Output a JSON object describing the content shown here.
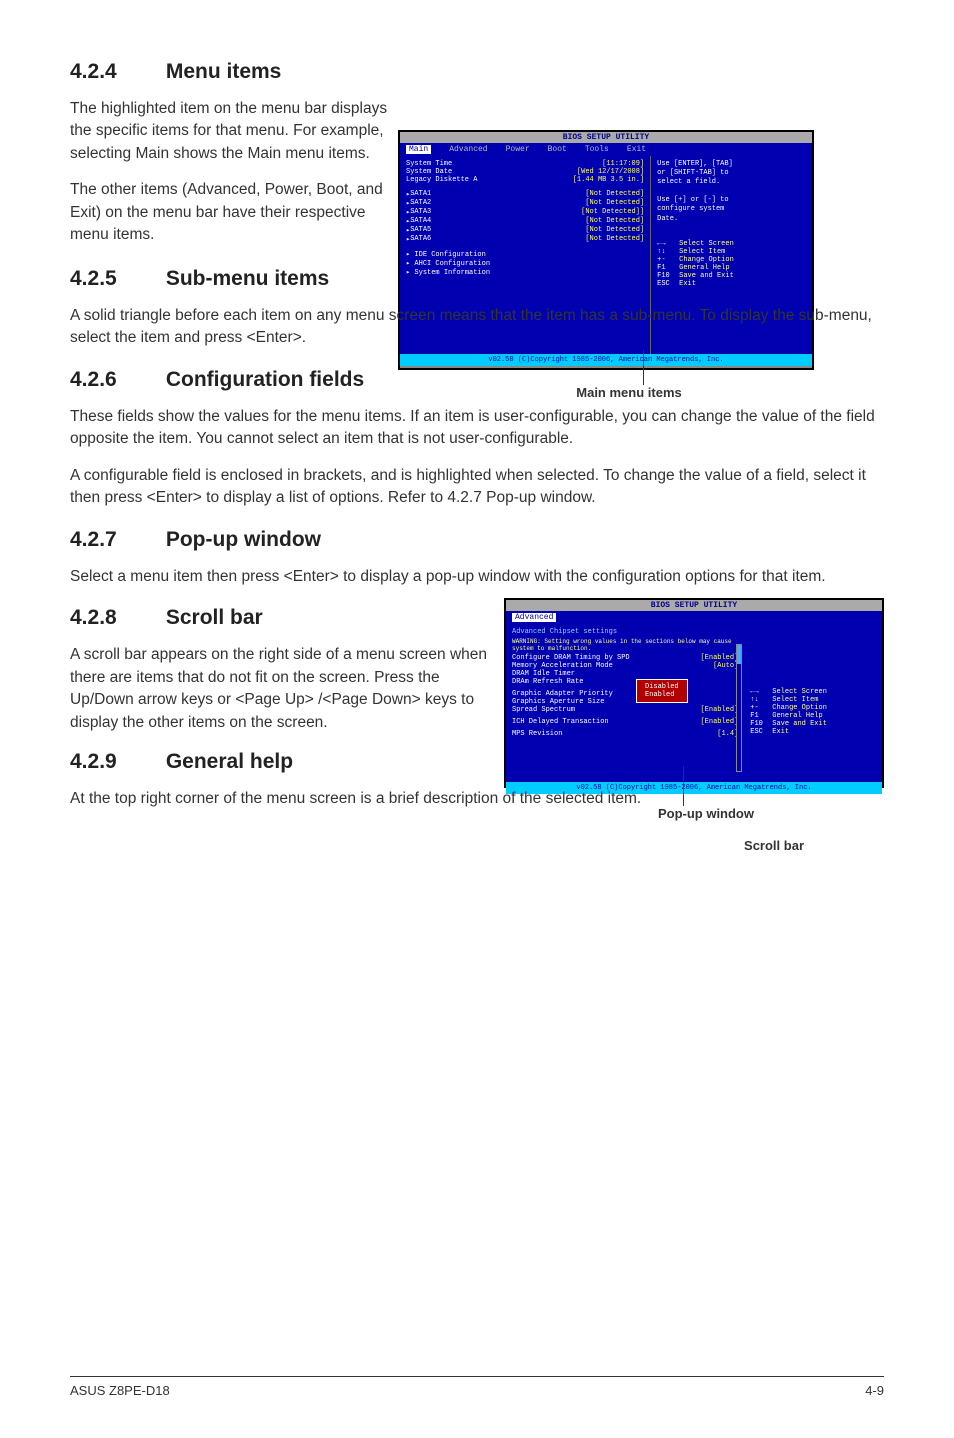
{
  "sections": {
    "s424": {
      "number": "4.2.4",
      "title": "Menu items",
      "p1": "The highlighted item on the menu bar displays the specific items for that menu. For example, selecting Main shows the Main menu items.",
      "p2": "The other items (Advanced, Power, Boot, and Exit) on the menu bar have their respective menu items."
    },
    "s425": {
      "number": "4.2.5",
      "title": "Sub-menu items",
      "p1": "A solid triangle before each item on any menu screen means that the item has a sub-menu. To display the sub-menu, select the item and press <Enter>."
    },
    "s426": {
      "number": "4.2.6",
      "title": "Configuration fields",
      "p1": "These fields show the values for the menu items. If an item is user-configurable, you can change the value of the field opposite the item. You cannot select an item that is not user-configurable.",
      "p2": "A configurable field is enclosed in brackets, and is highlighted when selected. To change the value of a field, select it then press <Enter> to display a list of options. Refer to 4.2.7 Pop-up window."
    },
    "s427": {
      "number": "4.2.7",
      "title": "Pop-up window",
      "p1": "Select a menu item then press <Enter> to display a pop-up window with the configuration options for that item."
    },
    "s428": {
      "number": "4.2.8",
      "title": "Scroll bar",
      "p1": "A scroll bar appears on the right side of a menu screen when there are items that do not fit on the screen. Press the Up/Down arrow keys or <Page Up> /<Page Down> keys to display the other items on the screen."
    },
    "s429": {
      "number": "4.2.9",
      "title": "General help",
      "p1": "At the top right corner of the menu screen is a brief description of the selected item."
    }
  },
  "captions": {
    "main_menu_items": "Main menu items",
    "popup_window": "Pop-up window",
    "scroll_bar": "Scroll bar"
  },
  "bios1": {
    "title": "BIOS SETUP UTILITY",
    "menu": [
      "Main",
      "Advanced",
      "Power",
      "Boot",
      "Tools",
      "Exit"
    ],
    "system_time_label": "System Time",
    "system_time_value": "[11:17:09]",
    "system_date_label": "System Date",
    "system_date_value": "[Wed 12/17/2008]",
    "legacy_diskette_label": "Legacy Diskette A",
    "legacy_diskette_value": "[1.44 MB 3.5 in.]",
    "sata_items": [
      "SATA1",
      "SATA2",
      "SATA3",
      "SATA4",
      "SATA5",
      "SATA6"
    ],
    "sata_value": "[Not Detected]",
    "sata_value3": "[Not Detected]]",
    "submenu_items": [
      "IDE Configuration",
      "AHCI Configuration",
      "System Information"
    ],
    "help_lines": [
      "Use [ENTER], [TAB]",
      "or [SHIFT-TAB] to",
      "select a field.",
      "",
      "Use [+] or [-] to",
      "configure system",
      "Date."
    ],
    "keys": [
      {
        "k": "←→",
        "txt": "Select Screen"
      },
      {
        "k": "↑↓",
        "txt": "Select Item"
      },
      {
        "k": "+-",
        "txt": "Change Option"
      },
      {
        "k": "F1",
        "txt": "General Help"
      },
      {
        "k": "F10",
        "txt": "Save and Exit"
      },
      {
        "k": "ESC",
        "txt": "Exit"
      }
    ],
    "footer": "v02.58 (C)Copyright 1985-2006, American Megatrends, Inc."
  },
  "bios2": {
    "title": "BIOS SETUP UTILITY",
    "tab": "Advanced",
    "heading": "Advanced Chipset settings",
    "warning": "WARNING: Setting wrong values in the sections below may cause system to malfunction.",
    "rows": [
      {
        "l": "Configure DRAM Timing by SPD",
        "v": "[Enabled]"
      },
      {
        "l": "Memory Acceleration Mode",
        "v": "[Auto]"
      },
      {
        "l": "DRAM Idle Timer",
        "v": ""
      },
      {
        "l": "DRAm Refresh Rate",
        "v": ""
      },
      {
        "l": "Graphic Adapter Priority",
        "v": ""
      },
      {
        "l": "Graphics Aperture Size",
        "v": ""
      },
      {
        "l": "Spread Spectrum",
        "v": "[Enabled]"
      },
      {
        "l": "ICH Delayed Transaction",
        "v": "[Enabled]"
      },
      {
        "l": "MPS Revision",
        "v": "[1.4]"
      }
    ],
    "popup_options": [
      "Disabled",
      "Enabled"
    ],
    "keys": [
      {
        "k": "←→",
        "txt": "Select Screen"
      },
      {
        "k": "↑↓",
        "txt": "Select Item"
      },
      {
        "k": "+-",
        "txt": "Change Option"
      },
      {
        "k": "F1",
        "txt": "General Help"
      },
      {
        "k": "F10",
        "txt": "Save and Exit"
      },
      {
        "k": "ESC",
        "txt": "Exit"
      }
    ],
    "footer": "v02.58 (C)Copyright 1985-2006, American Megatrends, Inc."
  },
  "footer": {
    "left": "ASUS Z8PE-D18",
    "right": "4-9"
  }
}
